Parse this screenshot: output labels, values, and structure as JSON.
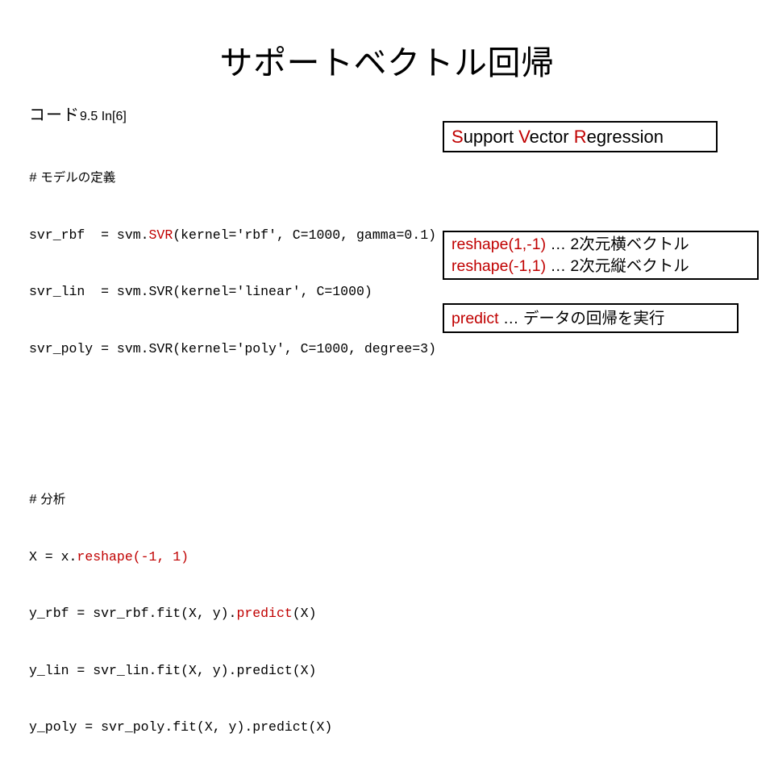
{
  "slide": {
    "title": "サポートベクトル回帰",
    "accent_color": "#c00000",
    "text_color": "#000000",
    "background_color": "#ffffff"
  },
  "code_panel": {
    "caption_jp": "コード",
    "caption_en": "9.5 In[6]",
    "block_one": {
      "comment_hash": "#",
      "comment_text": "モデルの定義",
      "line1_pre": "svr_rbf  = svm.",
      "line1_hl": "SVR",
      "line1_post": "(kernel='rbf', C=1000, gamma=0.1)",
      "line2": "svr_lin  = svm.SVR(kernel='linear', C=1000)",
      "line3": "svr_poly = svm.SVR(kernel='poly', C=1000, degree=3)"
    },
    "block_two": {
      "comment_hash": "#",
      "comment_text": "分析",
      "line1_pre": "X = x.",
      "line1_hl": "reshape(-1, 1)",
      "line2_pre": "y_rbf = svr_rbf.fit(X, y).",
      "line2_hl": "predict",
      "line2_post": "(X)",
      "line3": "y_lin = svr_lin.fit(X, y).predict(X)",
      "line4": "y_poly = svr_poly.fit(X, y).predict(X)"
    }
  },
  "notes": {
    "svr": {
      "part1_hl": "S",
      "part1": "upport ",
      "part2_hl": "V",
      "part2": "ector ",
      "part3_hl": "R",
      "part3": "egression"
    },
    "reshape": {
      "row1_hl": "reshape(1,-1)",
      "row1_text": " … 2次元横ベクトル",
      "row2_hl": "reshape(-1,1)",
      "row2_text": " … 2次元縦ベクトル"
    },
    "predict": {
      "row1_hl": "predict",
      "row1_text": " … データの回帰を実行"
    }
  }
}
